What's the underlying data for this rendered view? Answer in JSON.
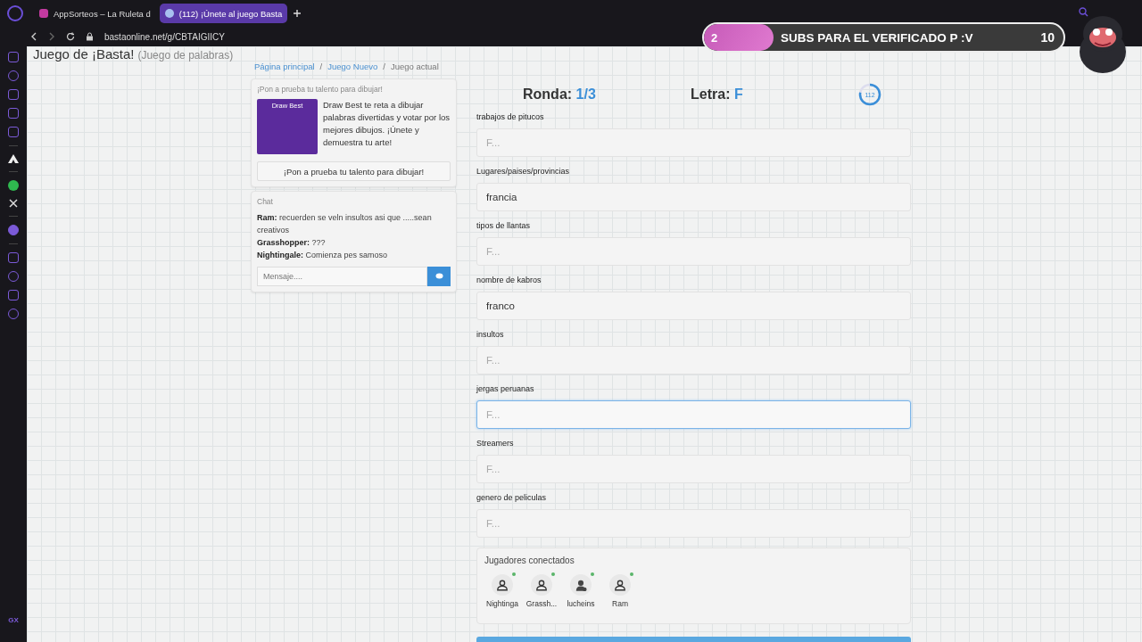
{
  "browser": {
    "tabs": [
      {
        "title": "AppSorteos – La Ruleta d",
        "selected": false
      },
      {
        "title": "(112) ¡Únete al juego Basta",
        "selected": true
      }
    ],
    "url": "bastaonline.net/g/CBTAIGIICY",
    "sidebar_badge": "GX"
  },
  "page": {
    "title": "Juego de ¡Basta!",
    "subtitle": "(Juego de palabras)"
  },
  "breadcrumb": [
    {
      "label": "Página principal",
      "kind": "link"
    },
    {
      "label": "/",
      "kind": "separator"
    },
    {
      "label": "Juego Nuevo",
      "kind": "link"
    },
    {
      "label": "/",
      "kind": "separator"
    },
    {
      "label": "Juego actual",
      "kind": "current"
    }
  ],
  "promo": {
    "heading": "¡Pon a prueba tu talento para dibujar!",
    "image_caption": "Draw Best",
    "text": "Draw Best te reta a dibujar palabras divertidas y votar por los mejores dibujos. ¡Únete y demuestra tu arte!",
    "button": "¡Pon a prueba tu talento para dibujar!"
  },
  "chat": {
    "title": "Chat",
    "messages": [
      {
        "author": "Ram:",
        "text": "recuerden se veln insultos asi que .....sean creativos"
      },
      {
        "author": "Grasshopper:",
        "text": "???"
      },
      {
        "author": "Nightingale:",
        "text": "Comienza pes samoso"
      }
    ],
    "placeholder": "Mensaje...."
  },
  "round": {
    "label": "Ronda:",
    "value": "1/3"
  },
  "letter": {
    "label": "Letra:",
    "value": "F"
  },
  "timer": {
    "value": "112",
    "level": 0.78
  },
  "fields": [
    {
      "label": "trabajos de pitucos",
      "placeholder": "F...",
      "focused": false
    },
    {
      "label": "Lugares/paises/provincias",
      "value": "francia",
      "focused": false
    },
    {
      "label": "tipos de llantas",
      "placeholder": "F...",
      "focused": false
    },
    {
      "label": "nombre de kabros",
      "value": "franco",
      "focused": false
    },
    {
      "label": "insultos",
      "placeholder": "F...",
      "focused": false
    },
    {
      "label": "jergas peruanas",
      "placeholder": "F...",
      "focused": true
    },
    {
      "label": "Streamers",
      "placeholder": "F...",
      "focused": false
    },
    {
      "label": "genero de peliculas",
      "placeholder": "F...",
      "focused": false
    }
  ],
  "players": {
    "title": "Jugadores conectados",
    "items": [
      {
        "name": "Nightinga",
        "kind": "outline",
        "online": true
      },
      {
        "name": "Grassh...",
        "kind": "outline",
        "online": true
      },
      {
        "name": "lucheins",
        "kind": "host",
        "online": true
      },
      {
        "name": "Ram",
        "kind": "outline",
        "online": true
      }
    ]
  },
  "overlay": {
    "count": "2",
    "text": "SUBS PARA EL VERIFICADO P :V",
    "number": "10"
  }
}
